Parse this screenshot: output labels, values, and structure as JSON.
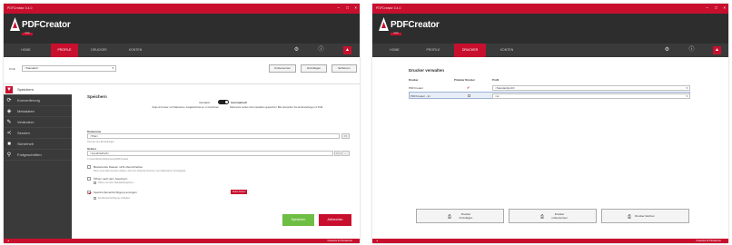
{
  "w1": {
    "title_bar": "PDFCreator 3.4.0",
    "brand": "PDFCreator",
    "badge": "FREE",
    "tabs": [
      "HOME",
      "PROFILE",
      "DRUCKER",
      "KONTEN"
    ],
    "profile_label": "Profil",
    "profile_value": "<Standard>",
    "profile_buttons": [
      "Umbenennen",
      "Hinzufügen",
      "Entfernen"
    ],
    "side_items": [
      "Speichern",
      "Konvertierung",
      "Metadaten",
      "Verändern",
      "Senden",
      "Sicherheit",
      "Fortgeschritten"
    ],
    "section_title": "Speichern",
    "mode_interactive": "Interaktiv",
    "mode_auto": "Automatisch",
    "mode_desc_left": "Zeigt ein Fenster, um Dateinamen, Ausgabeformat etc. zu bestimmen",
    "mode_desc_right": "Dokumente werden ohne Interaktion gespeichert. Bitte überprüfen Sie die Einstellungen im Profil.",
    "filename_label": "Dateiname",
    "filename_value": "<Title>",
    "filename_hint": "Titel aus den Einstellungen",
    "folder_label": "Ordner",
    "folder_value": "<InputFilePath>",
    "folder_hint": "C:\\Users\\Nutzer\\Dokumente\\PDFCreator",
    "opt1": "Bestehende Dateien nicht überschreiben",
    "opt1_sub": "Wenn eine Datei bereits existiert, wird eine laufende Nummer zum Dateinamen hinzugefügt.",
    "opt2": "Öffnen nach dem Speichern",
    "opt2_sub": "Öffnen mit dem Standardprogramm",
    "opt3": "Speicherbenachrichtigung anzeigen",
    "opt3_sub": "Die Benachrichtigung schließen",
    "warning": "Keine Lizenz",
    "save_btn": "Speichern",
    "cancel_btn": "Abbrechen",
    "footer": "Kostenlos für Privatnutzer"
  },
  "w2": {
    "title_bar": "PDFCreator 3.4.0",
    "brand": "PDFCreator",
    "badge": "FREE",
    "tabs": [
      "HOME",
      "PROFILE",
      "DRUCKER",
      "KONTEN"
    ],
    "section_title": "Drucker verwalten",
    "col_printer": "Drucker",
    "col_default": "Primärer Drucker",
    "col_profile": "Profil",
    "rows": [
      {
        "printer": "PDFCreator",
        "profile": "<Standardprofil>"
      },
      {
        "printer": "PDFCreator - 2x",
        "profile": "<a>"
      }
    ],
    "buttons": [
      "Drucker hinzufügen",
      "Drucker umbenennen",
      "Drucker löschen"
    ],
    "footer": "Kostenlos für Privatnutzer"
  },
  "colors": {
    "accent": "#c8102e",
    "dark": "#2d2d2d",
    "green": "#6fbe44"
  }
}
